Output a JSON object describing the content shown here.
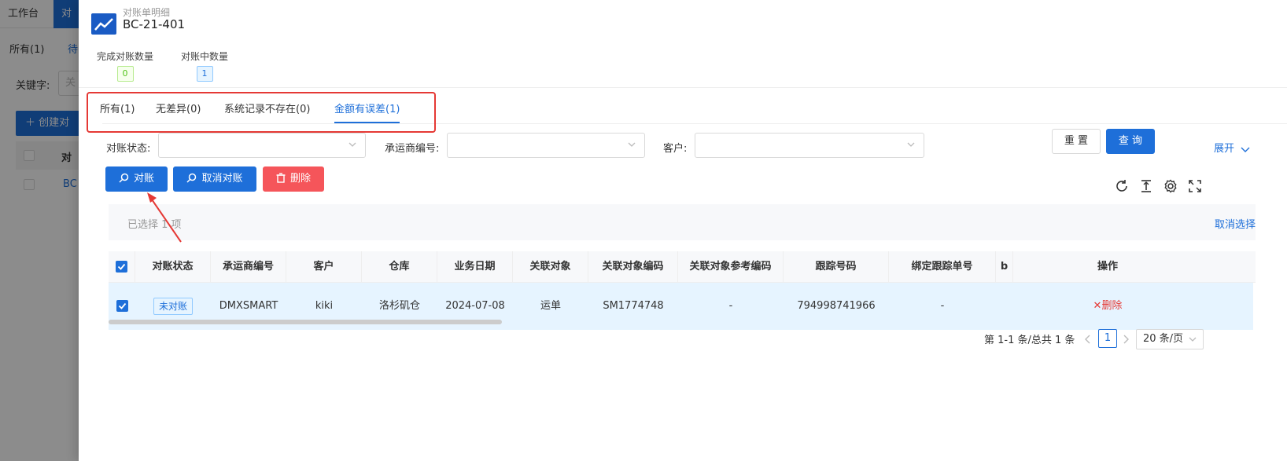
{
  "background": {
    "tabs": [
      "工作台",
      "对"
    ],
    "sub_tab_all": "所有(1)",
    "sub_tab_pending": "待",
    "keyword_label": "关键字:",
    "keyword_placeholder": "关",
    "create_button": "创建对",
    "table_header": "对",
    "table_cell": "BC"
  },
  "drawer": {
    "subtitle": "对账单明细",
    "title": "BC-21-401",
    "stats": [
      {
        "label": "完成对账数量",
        "value": "0"
      },
      {
        "label": "对账中数量",
        "value": "1"
      }
    ],
    "tabs": [
      {
        "label": "所有(1)",
        "active": false
      },
      {
        "label": "无差异(0)",
        "active": false
      },
      {
        "label": "系统记录不存在(0)",
        "active": false
      },
      {
        "label": "金额有误差(1)",
        "active": true
      }
    ],
    "filters": {
      "status_label": "对账状态:",
      "carrier_label": "承运商编号:",
      "customer_label": "客户:"
    },
    "buttons": {
      "reset": "重 置",
      "query": "查 询",
      "expand": "展开",
      "reconcile": "对账",
      "cancel_reconcile": "取消对账",
      "delete": "删除"
    },
    "selection": {
      "text": "已选择 1 项",
      "cancel": "取消选择"
    },
    "table": {
      "columns": [
        "对账状态",
        "承运商编号",
        "客户",
        "仓库",
        "业务日期",
        "关联对象",
        "关联对象编码",
        "关联对象参考编码",
        "跟踪号码",
        "绑定跟踪单号",
        "b",
        "操作"
      ],
      "rows": [
        {
          "status": "未对账",
          "carrier": "DMXSMART",
          "customer": "kiki",
          "warehouse": "洛杉矶仓",
          "date": "2024-07-08",
          "object": "运单",
          "object_code": "SM1774748",
          "ref_code": "-",
          "tracking": "794998741966",
          "bind_tracking": "-",
          "action": "删除"
        }
      ]
    },
    "pagination": {
      "summary": "第 1-1 条/总共 1 条",
      "current_page": "1",
      "page_size": "20 条/页"
    }
  },
  "colors": {
    "primary": "#1e6fd9",
    "danger": "#f5555a",
    "highlight": "#e53935"
  }
}
